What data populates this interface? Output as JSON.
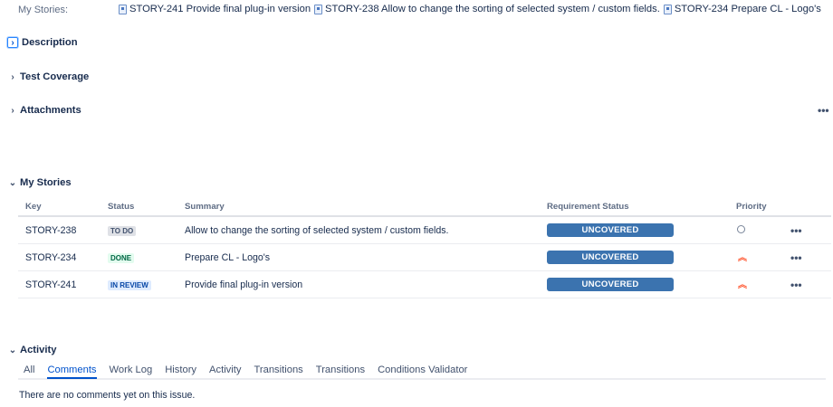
{
  "my_stories_field": {
    "label": "My Stories:",
    "links": [
      {
        "text": "STORY-241 Provide final plug-in version"
      },
      {
        "text": "STORY-238 Allow to change the sorting of selected system / custom fields."
      },
      {
        "text": "STORY-234 Prepare CL - Logo's"
      }
    ]
  },
  "sections": {
    "description": "Description",
    "test_coverage": "Test Coverage",
    "attachments": "Attachments",
    "my_stories": "My Stories",
    "activity": "Activity"
  },
  "more_glyph": "•••",
  "stories_table": {
    "columns": [
      "Key",
      "Status",
      "Summary",
      "Requirement Status",
      "Priority"
    ],
    "rows": [
      {
        "key": "STORY-238",
        "status": "TO DO",
        "summary": "Allow to change the sorting of selected system / custom fields.",
        "requirement": "UNCOVERED",
        "priority_icon": "priority-minor-icon"
      },
      {
        "key": "STORY-234",
        "status": "DONE",
        "summary": "Prepare CL - Logo's",
        "requirement": "UNCOVERED",
        "priority_icon": "priority-highest-icon"
      },
      {
        "key": "STORY-241",
        "status": "IN REVIEW",
        "summary": "Provide final plug-in version",
        "requirement": "UNCOVERED",
        "priority_icon": "priority-highest-icon"
      }
    ]
  },
  "activity": {
    "tabs": [
      "All",
      "Comments",
      "Work Log",
      "History",
      "Activity",
      "Transitions",
      "Transitions",
      "Conditions Validator"
    ],
    "active_tab": "Comments",
    "empty_message": "There are no comments yet on this issue."
  },
  "colors": {
    "accent": "#0052cc",
    "requirement_uncovered": "#3b73af",
    "priority_high": "#ff5630"
  }
}
